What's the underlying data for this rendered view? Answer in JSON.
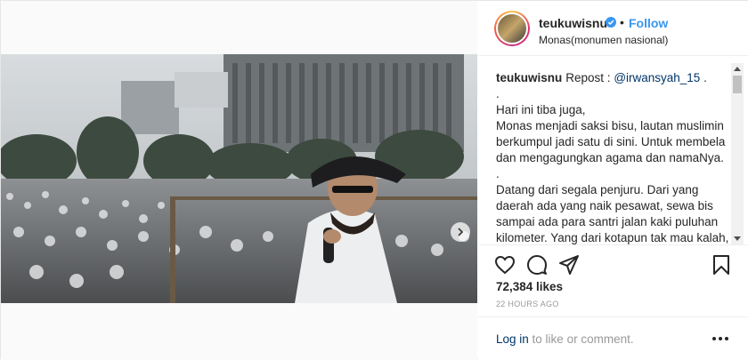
{
  "header": {
    "username": "teukuwisnu",
    "separator": "•",
    "follow_label": "Follow",
    "location": "Monas(monumen nasional)"
  },
  "caption": {
    "username": "teukuwisnu",
    "repost_text": "Repost :",
    "mention": "@irwansyah_15",
    "mention_suffix": ".",
    "lines": [
      ".",
      "Hari ini tiba juga,",
      "Monas menjadi saksi bisu, lautan muslimin berkumpul jadi satu di sini. Untuk membela dan mengagungkan agama dan namaNya.",
      ".",
      "Datang dari segala penjuru. Dari yang daerah ada yang naik pesawat, sewa bis sampai ada para santri jalan kaki puluhan kilometer. Yang dari kotapun tak mau kalah, menyambut mereka dengan"
    ]
  },
  "stats": {
    "likes": "72,384 likes",
    "time": "22 HOURS AGO"
  },
  "login": {
    "link": "Log in",
    "rest": " to like or comment."
  },
  "icons": {
    "verified": "verified-badge-icon",
    "like": "heart-icon",
    "comment": "comment-bubble-icon",
    "share": "share-paper-plane-icon",
    "save": "bookmark-icon",
    "more": "more-dots-icon",
    "next": "chevron-right-icon"
  },
  "colors": {
    "link": "#3897f0",
    "mention": "#003569",
    "text": "#262626",
    "muted": "#999999"
  }
}
